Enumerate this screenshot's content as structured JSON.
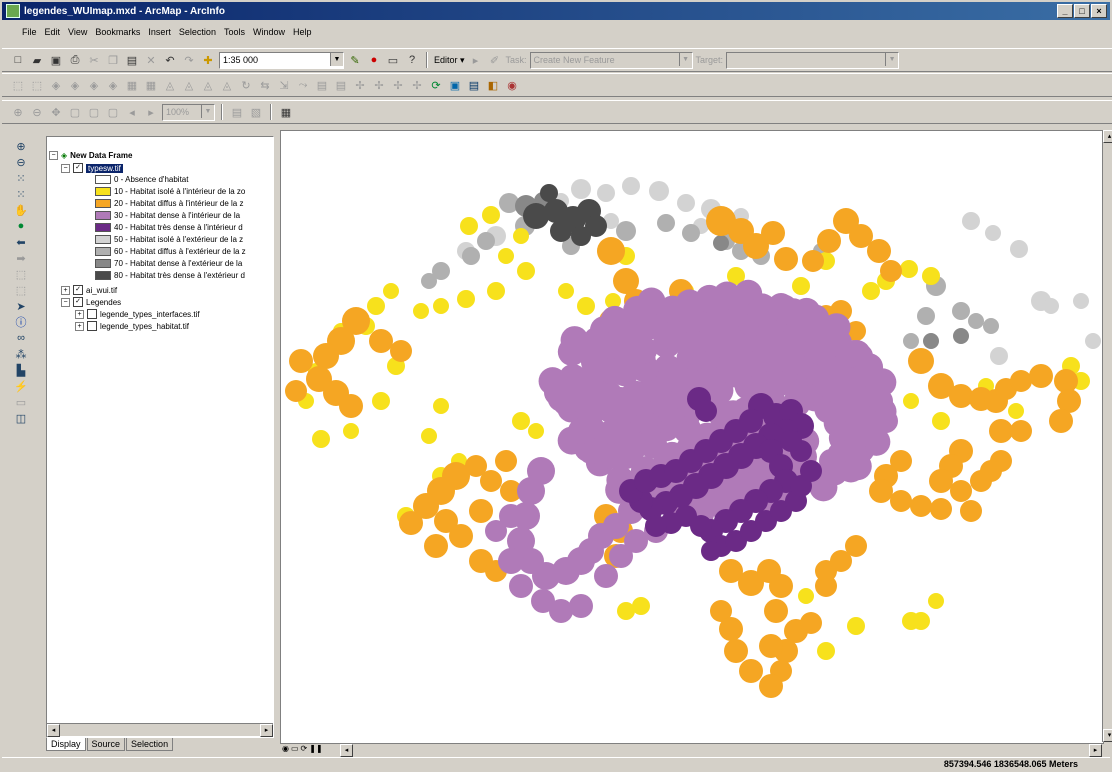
{
  "window": {
    "title": "legendes_WUImap.mxd - ArcMap - ArcInfo",
    "buttons": [
      "_",
      "□",
      "×"
    ]
  },
  "menu": [
    "File",
    "Edit",
    "View",
    "Bookmarks",
    "Insert",
    "Selection",
    "Tools",
    "Window",
    "Help"
  ],
  "toolbar": {
    "scale_value": "1:35 000",
    "editor_label": "Editor ▾",
    "task_label": "Task:",
    "task_value": "Create New Feature",
    "target_label": "Target:",
    "target_value": "",
    "zoom_value": "100%"
  },
  "toc": {
    "frame": "New Data Frame",
    "active_layer": "typesw.tif",
    "legend_items": [
      {
        "label": "0 - Absence d'habitat",
        "color": "#ffffff"
      },
      {
        "label": "10 - Habitat isolé à l'intérieur de la zo",
        "color": "#f7e11c"
      },
      {
        "label": "20 - Habitat diffus à l'intérieur de la z",
        "color": "#f5a623"
      },
      {
        "label": "30 - Habitat dense à l'intérieur de la",
        "color": "#b07ab8"
      },
      {
        "label": "40 - Habitat très dense à l'intérieur d",
        "color": "#6b2a86"
      },
      {
        "label": "50 - Habitat isolé à l'extérieur de la z",
        "color": "#d3d3d3"
      },
      {
        "label": "60 - Habitat diffus à l'extérieur de la z",
        "color": "#b0b0b0"
      },
      {
        "label": "70 - Habitat dense à l'extérieur de la",
        "color": "#888888"
      },
      {
        "label": "80 - Habitat très dense à l'extérieur d",
        "color": "#4a4a4a"
      }
    ],
    "other_layers": {
      "ai_wui": "ai_wui.tif",
      "legendes": "Legendes",
      "legende_interfaces": "legende_types_interfaces.tif",
      "legende_habitat": "legende_types_habitat.tif"
    },
    "tabs": [
      "Display",
      "Source",
      "Selection"
    ]
  },
  "status": {
    "coords": "857394.546  1836548.065 Meters"
  },
  "colors": {
    "isole_int": "#f7e11c",
    "diffus_int": "#f5a623",
    "dense_int": "#b07ab8",
    "tres_dense_int": "#6b2a86",
    "isole_ext": "#d3d3d3",
    "diffus_ext": "#b0b0b0",
    "dense_ext": "#888888",
    "tres_dense_ext": "#4a4a4a"
  }
}
